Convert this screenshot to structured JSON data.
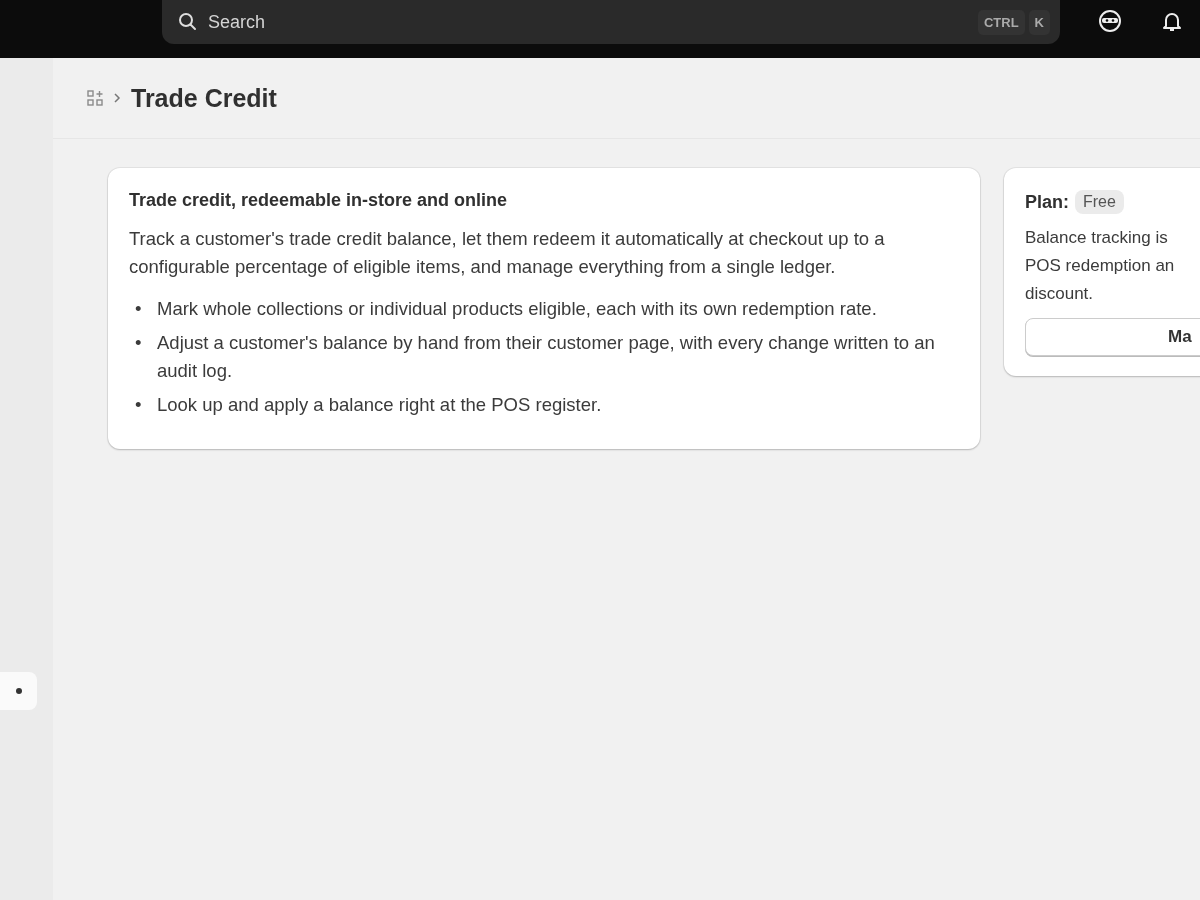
{
  "top_bar": {
    "search": {
      "placeholder": "Search",
      "shortcut_keys": [
        "CTRL",
        "K"
      ]
    }
  },
  "breadcrumb": {
    "title": "Trade Credit"
  },
  "feature_card": {
    "title": "Trade credit, redeemable in-store and online",
    "description": "Track a customer's trade credit balance, let them redeem it automatically at checkout up to a configurable percentage of eligible items, and manage everything from a single ledger.",
    "bullets": [
      {
        "marker": "•",
        "text": "Mark whole collections or individual products eligible, each with its own redemption rate."
      },
      {
        "marker": "•",
        "text": "Adjust a customer's balance by hand from their customer page, with every change written to an audit log."
      },
      {
        "marker": "•",
        "text": "Look up and apply a balance right at the POS register."
      }
    ]
  },
  "plan_card": {
    "label": "Plan:",
    "badge": "Free",
    "lines": [
      "Balance tracking is",
      "POS redemption an",
      "discount."
    ],
    "button": "Ma"
  }
}
